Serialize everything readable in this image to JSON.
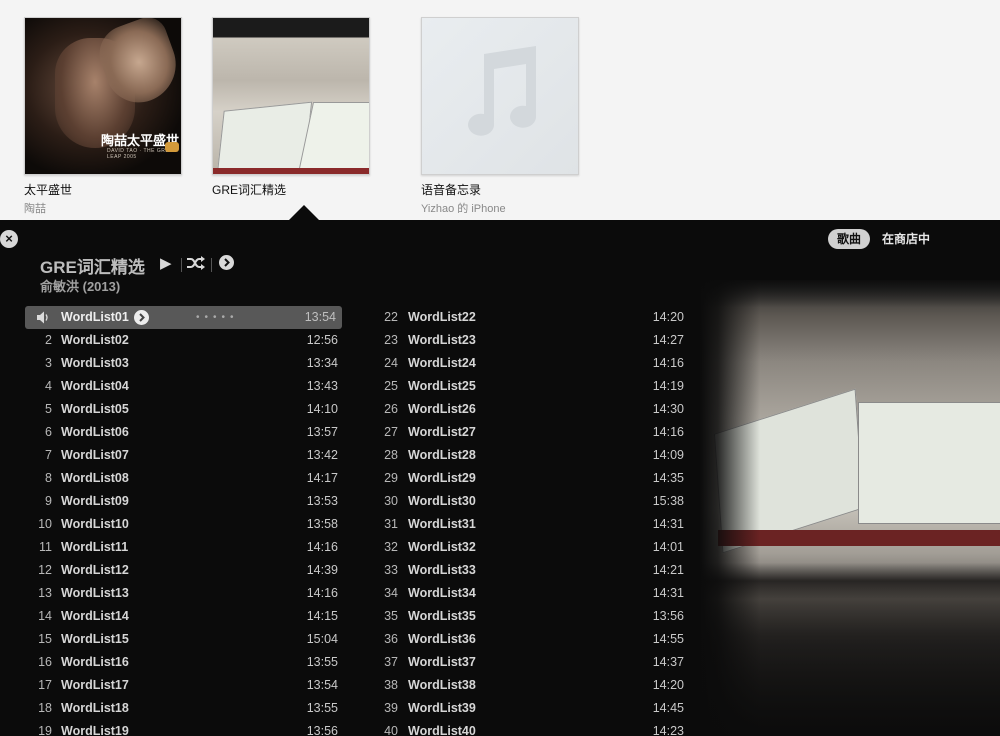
{
  "albums": [
    {
      "title": "太平盛世",
      "artist": "陶喆",
      "cover_text": "陶喆太平盛世",
      "cover_sub": "DAVID TAO · THE GREAT LEAP 2005"
    },
    {
      "title": "GRE词汇精选",
      "artist": ""
    },
    {
      "title": "语音备忘录",
      "artist": "Yizhao 的 iPhone"
    }
  ],
  "panel": {
    "close": "×",
    "seg_songs": "歌曲",
    "seg_store": "在商店中",
    "title": "GRE词汇精选",
    "subtitle": "俞敏洪 (2013)",
    "play": "▶",
    "now_playing_dots": "•••••",
    "icons": [
      "close-icon",
      "play-icon",
      "shuffle-icon",
      "more-icon",
      "speaker-icon"
    ]
  },
  "tracks_col1": [
    {
      "num": "",
      "name": "WordList01",
      "dur": "13:54"
    },
    {
      "num": "2",
      "name": "WordList02",
      "dur": "12:56"
    },
    {
      "num": "3",
      "name": "WordList03",
      "dur": "13:34"
    },
    {
      "num": "4",
      "name": "WordList04",
      "dur": "13:43"
    },
    {
      "num": "5",
      "name": "WordList05",
      "dur": "14:10"
    },
    {
      "num": "6",
      "name": "WordList06",
      "dur": "13:57"
    },
    {
      "num": "7",
      "name": "WordList07",
      "dur": "13:42"
    },
    {
      "num": "8",
      "name": "WordList08",
      "dur": "14:17"
    },
    {
      "num": "9",
      "name": "WordList09",
      "dur": "13:53"
    },
    {
      "num": "10",
      "name": "WordList10",
      "dur": "13:58"
    },
    {
      "num": "11",
      "name": "WordList11",
      "dur": "14:16"
    },
    {
      "num": "12",
      "name": "WordList12",
      "dur": "14:39"
    },
    {
      "num": "13",
      "name": "WordList13",
      "dur": "14:16"
    },
    {
      "num": "14",
      "name": "WordList14",
      "dur": "14:15"
    },
    {
      "num": "15",
      "name": "WordList15",
      "dur": "15:04"
    },
    {
      "num": "16",
      "name": "WordList16",
      "dur": "13:55"
    },
    {
      "num": "17",
      "name": "WordList17",
      "dur": "13:54"
    },
    {
      "num": "18",
      "name": "WordList18",
      "dur": "13:55"
    },
    {
      "num": "19",
      "name": "WordList19",
      "dur": "13:56"
    }
  ],
  "tracks_col2": [
    {
      "num": "22",
      "name": "WordList22",
      "dur": "14:20"
    },
    {
      "num": "23",
      "name": "WordList23",
      "dur": "14:27"
    },
    {
      "num": "24",
      "name": "WordList24",
      "dur": "14:16"
    },
    {
      "num": "25",
      "name": "WordList25",
      "dur": "14:19"
    },
    {
      "num": "26",
      "name": "WordList26",
      "dur": "14:30"
    },
    {
      "num": "27",
      "name": "WordList27",
      "dur": "14:16"
    },
    {
      "num": "28",
      "name": "WordList28",
      "dur": "14:09"
    },
    {
      "num": "29",
      "name": "WordList29",
      "dur": "14:35"
    },
    {
      "num": "30",
      "name": "WordList30",
      "dur": "15:38"
    },
    {
      "num": "31",
      "name": "WordList31",
      "dur": "14:31"
    },
    {
      "num": "32",
      "name": "WordList32",
      "dur": "14:01"
    },
    {
      "num": "33",
      "name": "WordList33",
      "dur": "14:21"
    },
    {
      "num": "34",
      "name": "WordList34",
      "dur": "14:31"
    },
    {
      "num": "35",
      "name": "WordList35",
      "dur": "13:56"
    },
    {
      "num": "36",
      "name": "WordList36",
      "dur": "14:55"
    },
    {
      "num": "37",
      "name": "WordList37",
      "dur": "14:37"
    },
    {
      "num": "38",
      "name": "WordList38",
      "dur": "14:20"
    },
    {
      "num": "39",
      "name": "WordList39",
      "dur": "14:45"
    },
    {
      "num": "40",
      "name": "WordList40",
      "dur": "14:23"
    }
  ]
}
